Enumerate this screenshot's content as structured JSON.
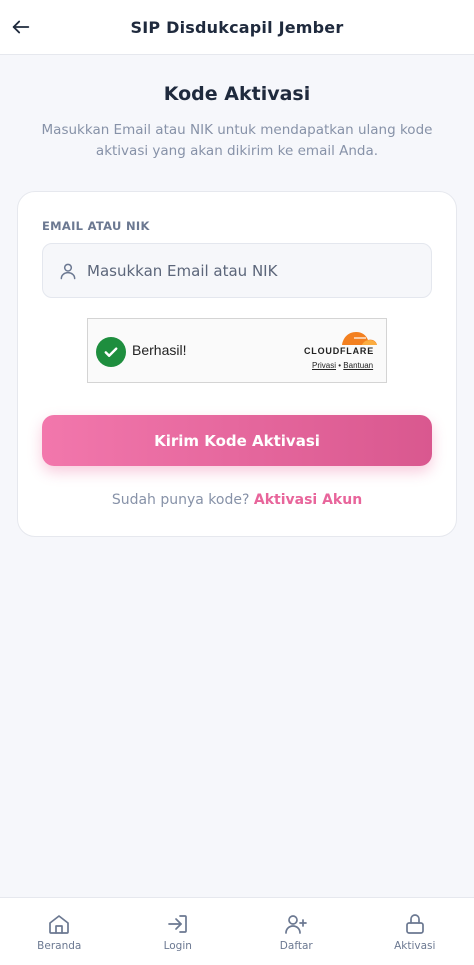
{
  "appbar": {
    "title": "SIP Disdukcapil Jember",
    "back_icon": "arrow-left-icon"
  },
  "page": {
    "title": "Kode Aktivasi",
    "description": "Masukkan Email atau NIK untuk mendapatkan ulang kode aktivasi yang akan dikirim ke email Anda."
  },
  "form": {
    "label": "EMAIL ATAU NIK",
    "input_placeholder": "Masukkan Email atau NIK",
    "input_value": "",
    "input_icon": "user-icon",
    "submit_label": "Kirim Kode Aktivasi",
    "footer_text": "Sudah punya kode?",
    "footer_link": "Aktivasi Akun"
  },
  "captcha": {
    "status": "Berhasil!",
    "brand": "CLOUDFLARE",
    "privacy": "Privasi",
    "separator": "•",
    "help": "Bantuan"
  },
  "nav": {
    "items": [
      {
        "label": "Beranda",
        "icon": "home-icon"
      },
      {
        "label": "Login",
        "icon": "login-icon"
      },
      {
        "label": "Daftar",
        "icon": "user-plus-icon"
      },
      {
        "label": "Aktivasi",
        "icon": "lock-icon"
      }
    ]
  },
  "colors": {
    "accent": "#e8659b",
    "button_gradient_start": "#f277ac",
    "button_gradient_end": "#d9588f",
    "success": "#1e8e3e",
    "cloudflare_orange": "#f38020"
  }
}
